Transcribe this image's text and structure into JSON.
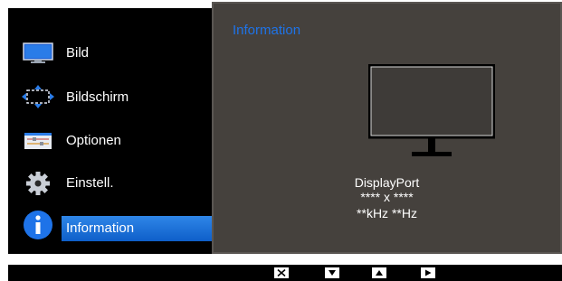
{
  "sidebar": {
    "items": [
      {
        "label": "Bild",
        "icon": "picture-icon"
      },
      {
        "label": "Bildschirm",
        "icon": "screen-size-icon"
      },
      {
        "label": "Optionen",
        "icon": "options-sliders-icon"
      },
      {
        "label": "Einstell.",
        "icon": "gear-icon"
      },
      {
        "label": "Information",
        "icon": "info-icon",
        "active": true
      }
    ]
  },
  "panel": {
    "title": "Information",
    "connection": "DisplayPort",
    "resolution": "**** x ****",
    "frequency": "**kHz **Hz"
  },
  "bottom_bar": {
    "keys": [
      "close-icon",
      "down-arrow-icon",
      "up-arrow-icon",
      "play-right-icon"
    ]
  },
  "colors": {
    "accent": "#1e73e8",
    "highlight": "#1a6fd8",
    "panel_bg": "#45413d",
    "background": "#000000"
  }
}
